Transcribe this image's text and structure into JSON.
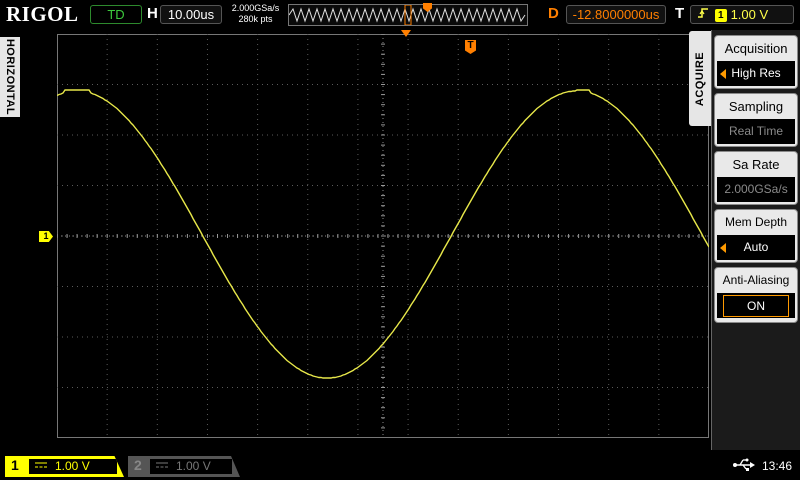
{
  "brand": "RIGOL",
  "run_state": "TD",
  "horizontal": {
    "letter": "H",
    "timebase": "10.00us",
    "sample_rate": "2.000GSa/s",
    "mem_points": "280k pts",
    "panel_label": "HORIZONTAL"
  },
  "delay": {
    "letter": "D",
    "value": "-12.8000000us"
  },
  "trigger": {
    "letter": "T",
    "source": "1",
    "level": "1.00 V",
    "marker": "T"
  },
  "acquire_menu": {
    "tab_label": "ACQUIRE",
    "items": [
      {
        "title": "Acquisition",
        "value": "High Res"
      },
      {
        "title": "Sampling",
        "value": "Real Time"
      },
      {
        "title": "Sa Rate",
        "value": "2.000GSa/s"
      },
      {
        "title": "Mem Depth",
        "value": "Auto"
      },
      {
        "title": "Anti-Aliasing",
        "value": "ON"
      }
    ]
  },
  "channels": [
    {
      "num": "1",
      "coupling": "DC",
      "scale": "1.00 V",
      "color": "#ffff00",
      "active": true
    },
    {
      "num": "2",
      "coupling": "DC",
      "scale": "1.00 V",
      "color": "#555555",
      "active": false
    }
  ],
  "ch1_marker": "1",
  "clock": "13:46",
  "icons": {
    "usb": "usb-icon",
    "trigger_edge": "rising-edge-icon"
  },
  "colors": {
    "trace": "#e8e84a",
    "grid": "#5a5a5a",
    "delay": "#ff7f00",
    "run": "#3cc83c"
  }
}
